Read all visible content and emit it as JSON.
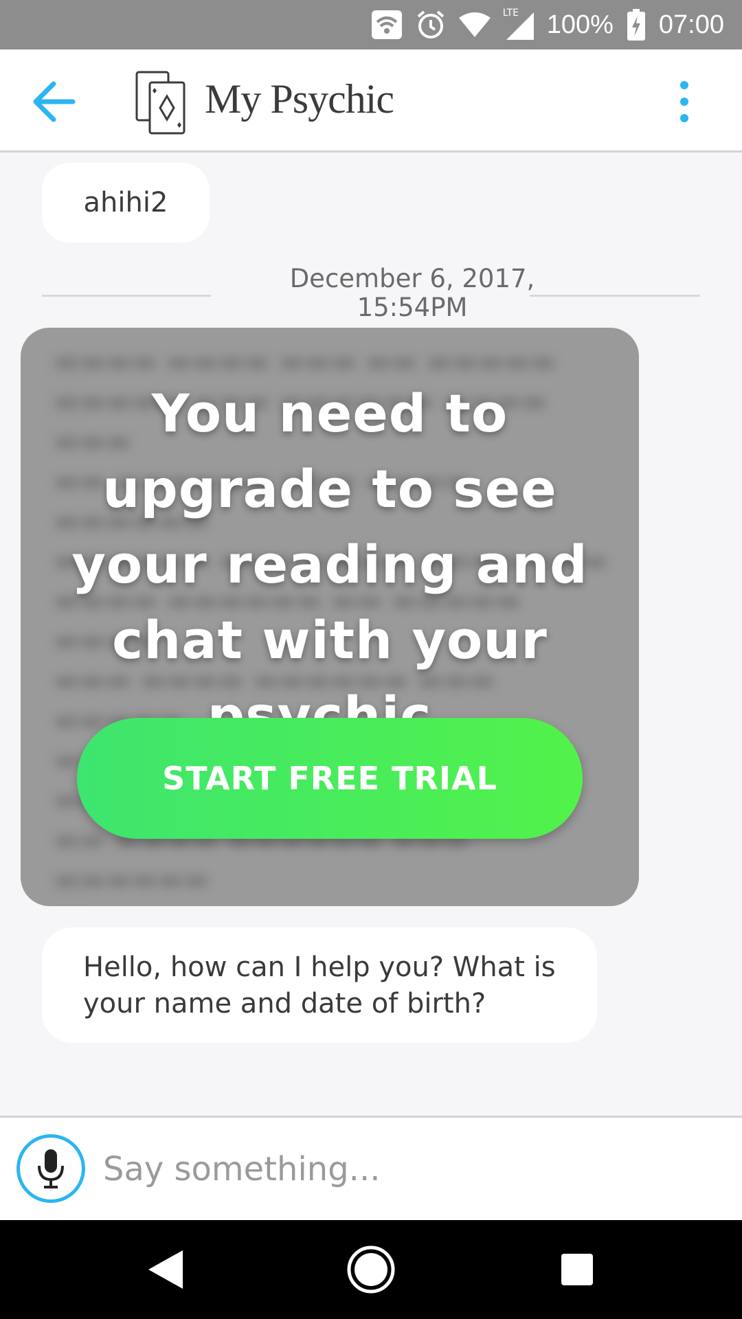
{
  "status_bar": {
    "battery": "100%",
    "time": "07:00",
    "network": "LTE",
    "icons": [
      "wifi-hotspot-icon",
      "alarm-icon",
      "wifi-icon",
      "signal-icon",
      "battery-charging-icon"
    ]
  },
  "app_bar": {
    "title": "My Psychic",
    "back_icon": "arrow-left-icon",
    "menu_icon": "more-vertical-icon",
    "logo_icon": "cards-logo-icon"
  },
  "chat": {
    "user_message": "ahihi2",
    "date_separator": {
      "line1": "December 6, 2017,",
      "line2": "15:54PM"
    },
    "locked_reading": {
      "message": "You need to upgrade to see your reading and chat with your psychic.",
      "button_label": "START FREE TRIAL"
    },
    "psychic_message": "Hello, how can I help you? What is your name and date of birth?"
  },
  "input_bar": {
    "placeholder": "Say something...",
    "mic_icon": "microphone-icon"
  },
  "colors": {
    "accent": "#2bb5f2",
    "trial_button_start": "#3ee56e",
    "trial_button_end": "#52f24a",
    "locked_card": "#9a9a9a",
    "status_bar": "#8d8d8d"
  },
  "nav_bar": {
    "icons": [
      "back-triangle-icon",
      "home-circle-icon",
      "recents-square-icon"
    ]
  }
}
